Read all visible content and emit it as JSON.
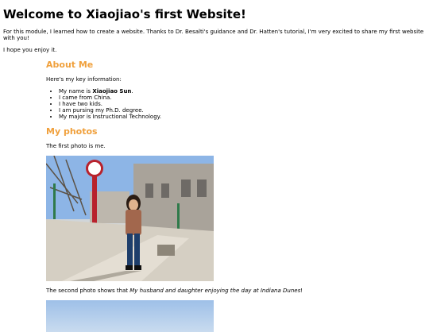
{
  "page": {
    "heading": "Welcome to Xiaojiao's first Website!",
    "intro": "For this module, I learned how to create a website. Thanks to Dr. Besalti's guidance and Dr. Hatten's tutorial, I'm very excited to share my first website with you!",
    "enjoy": "I hope you enjoy it."
  },
  "about": {
    "title": "About Me",
    "lead": "Here's my key information:",
    "name_prefix": "My name is ",
    "name": "Xiaojiao Sun",
    "name_suffix": ".",
    "items": [
      "I came from China.",
      "I have two kids.",
      "I am pursing my Ph.D. degree.",
      "My major is Instructional Technology."
    ]
  },
  "photos": {
    "title": "My photos",
    "first_caption": "The first photo is me.",
    "second_prefix": "The second photo shows that ",
    "second_italic": "My husband and daughter enjoying the day at Indiana Dunes",
    "second_suffix": "!"
  },
  "colors": {
    "section_heading": "#f0a03c"
  }
}
